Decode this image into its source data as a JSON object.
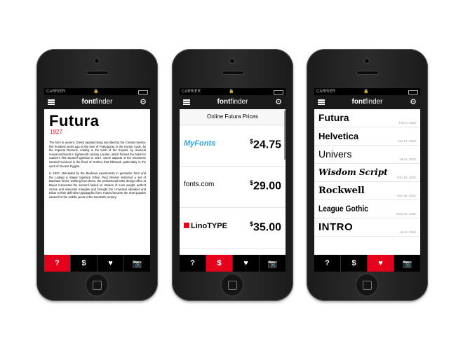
{
  "status": {
    "carrier": "CARRIER"
  },
  "app": {
    "logo_bold": "font",
    "logo_light": "finder"
  },
  "screen1": {
    "title": "Futura",
    "year": "1927",
    "paragraph1": "The form is ancient, Greek capitals being inscribed by the Cretans twenty-five hundred years ago at the time of Pythagoras in the Gortyn Code, by the Imperial Romans, notably in the tomb of the Scipios, by classical revival architects in eighteenth century London, which formed the basis for Caslon's first sanserif typeface in 1817. Some aspects of the Geometric sanserif survived in the flood of Gothics that followed; particularly in the work of Vincent Figgins.",
    "paragraph2": "In 1927, stimulated by the Bauhaus experiments in geometric form and the Ludwig & Mayer typeface Erbar, Paul Renner sketched a set of Bauhaus forms; working from these, the professional letter design office at Bauer reinvented the sanserif based on strokes of even weight, perfect circles and isosceles triangles and brought the Universal Alphabet and Erbar to their definitive typographic form. Futura became the most popular sanserif of the middle years of the twentieth century."
  },
  "screen2": {
    "heading": "Online Futura Prices",
    "vendors": [
      {
        "name": "MyFonts",
        "price": "24.75"
      },
      {
        "name": "fonts.com",
        "price": "29.00"
      },
      {
        "name": "LinoTYPE",
        "price": "35.00"
      }
    ]
  },
  "screen3": {
    "fonts": [
      {
        "name": "Futura",
        "date": "Feb 3, 2013"
      },
      {
        "name": "Helvetica",
        "date": "Jan 17, 2013"
      },
      {
        "name": "Univers",
        "date": "Jan 4, 2013"
      },
      {
        "name": "Wisdom Script",
        "date": "Dec 19, 2012"
      },
      {
        "name": "Rockwell",
        "date": "Nov 26, 2012"
      },
      {
        "name": "League Gothic",
        "date": "Sept 20, 2012"
      },
      {
        "name": "INTRO",
        "date": "Jun 8, 2012"
      }
    ]
  },
  "tabs": [
    {
      "label": "?",
      "icon": "help-icon"
    },
    {
      "label": "$",
      "icon": "dollar-icon"
    },
    {
      "label": "♥",
      "icon": "heart-icon"
    },
    {
      "label": "📷",
      "icon": "camera-icon"
    }
  ],
  "colors": {
    "accent": "#e5001b",
    "myfonts": "#29a7df"
  }
}
